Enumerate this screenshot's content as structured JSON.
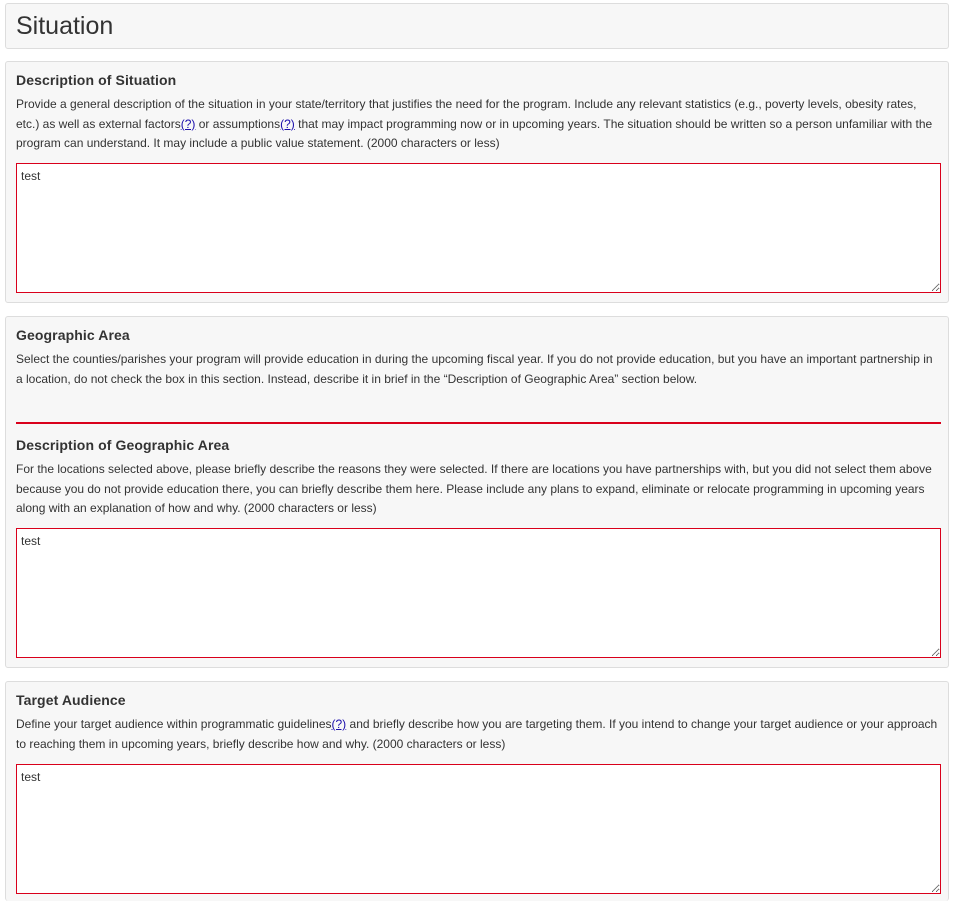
{
  "header": {
    "title": "Situation"
  },
  "situation": {
    "heading": "Description of Situation",
    "desc_part1": "Provide a general description of the situation in your state/territory that justifies the need for the program. Include any relevant statistics (e.g., poverty levels, obesity rates, etc.) as well as external factors",
    "help_link_1": "(?)",
    "desc_part2": " or assumptions",
    "help_link_2": "(?)",
    "desc_part3": " that may impact programming now or in upcoming years. The situation should be written so a person unfamiliar with the program can understand. It may include a public value statement. (2000 characters or less)",
    "value": "test"
  },
  "geographic": {
    "heading": "Geographic Area",
    "desc": "Select the counties/parishes your program will provide education in during the upcoming fiscal year. If you do not provide education, but you have an important partnership in a location, do not check the box in this section. Instead, describe it in brief in the “Description of Geographic Area” section below.",
    "description_heading": "Description of Geographic Area",
    "description_desc": "For the locations selected above, please briefly describe the reasons they were selected. If there are locations you have partnerships with, but you did not select them above because you do not provide education there, you can briefly describe them here. Please include any plans to expand, eliminate or relocate programming in upcoming years along with an explanation of how and why. (2000 characters or less)",
    "value": "test"
  },
  "target": {
    "heading": "Target Audience",
    "desc_part1": "Define your target audience within programmatic guidelines",
    "help_link": "(?)",
    "desc_part2": " and briefly describe how you are targeting them. If you intend to change your target audience or your approach to reaching them in upcoming years, briefly describe how and why. (2000 characters or less)",
    "value": "test"
  }
}
